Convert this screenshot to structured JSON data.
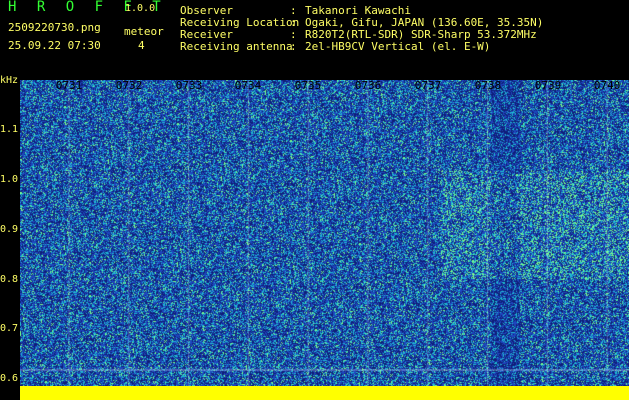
{
  "header": {
    "app_title": "H R O F F T",
    "app_version": "1.0.0",
    "file_name": "2509220730.png",
    "capture_time": "25.09.22 07:30",
    "detect_label": "meteor",
    "detect_count": "4"
  },
  "station_info": [
    {
      "label": "Observer",
      "value": "Takanori Kawachi"
    },
    {
      "label": "Receiving Location",
      "value": "Ogaki, Gifu, JAPAN (136.60E, 35.35N)"
    },
    {
      "label": "Receiver",
      "value": "R820T2(RTL-SDR) SDR-Sharp 53.372MHz"
    },
    {
      "label": "Receiving antenna",
      "value": "2el-HB9CV Vertical (el. E-W)"
    }
  ],
  "axis": {
    "y_unit": "kHz",
    "y_ticks": [
      "1.1",
      "1.0",
      "0.9",
      "0.8",
      "0.7",
      "0.6"
    ],
    "x_ticks": [
      "0731",
      "0732",
      "0733",
      "0734",
      "0735",
      "0736",
      "0737",
      "0738",
      "0739",
      "0740"
    ]
  },
  "colors": {
    "background": "#000000",
    "text": "#ffff66",
    "title": "#33ff33",
    "spectro_base": "#1f3fb0",
    "spectro_noise": "#1ec0d0",
    "spectro_highlight": "#7dff8a",
    "baseline": "#ffff00"
  }
}
